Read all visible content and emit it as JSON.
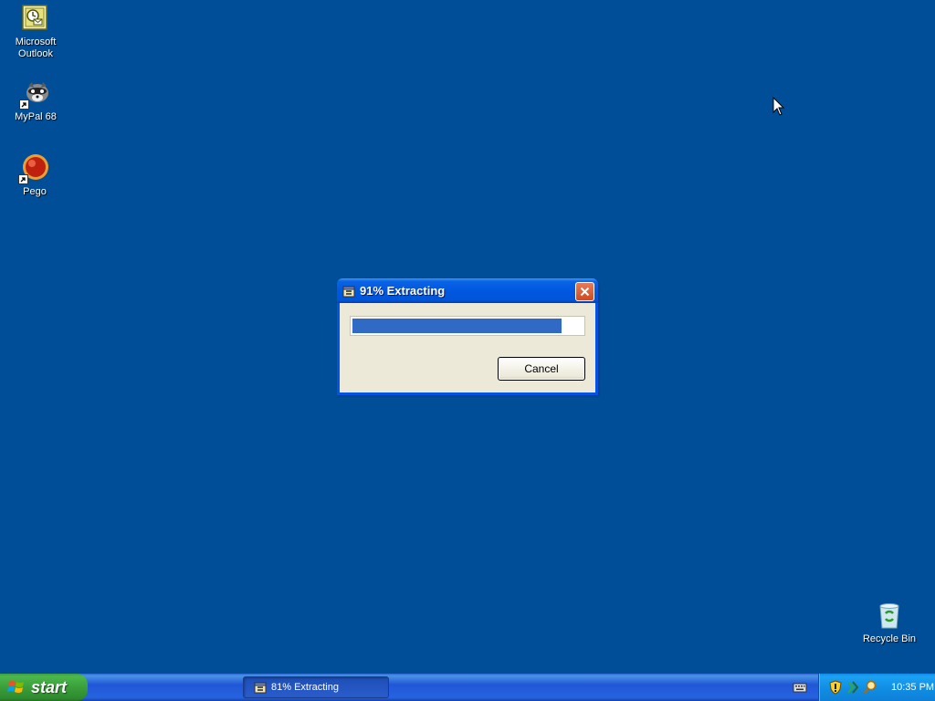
{
  "desktop": {
    "icons": [
      {
        "label_line1": "Microsoft",
        "label_line2": "Outlook",
        "icon": "outlook-icon"
      },
      {
        "label": "MyPal 68",
        "icon": "mypal-icon"
      },
      {
        "label": "Pego",
        "icon": "pego-icon"
      },
      {
        "label": "Recycle Bin",
        "icon": "recycle-bin-icon"
      }
    ],
    "background_color": "#004e98"
  },
  "dialog": {
    "title": "91% Extracting",
    "progress_percent": 91,
    "cancel_label": "Cancel"
  },
  "taskbar": {
    "start_label": "start",
    "task_item_label": "81% Extracting",
    "clock": "10:35 PM"
  }
}
